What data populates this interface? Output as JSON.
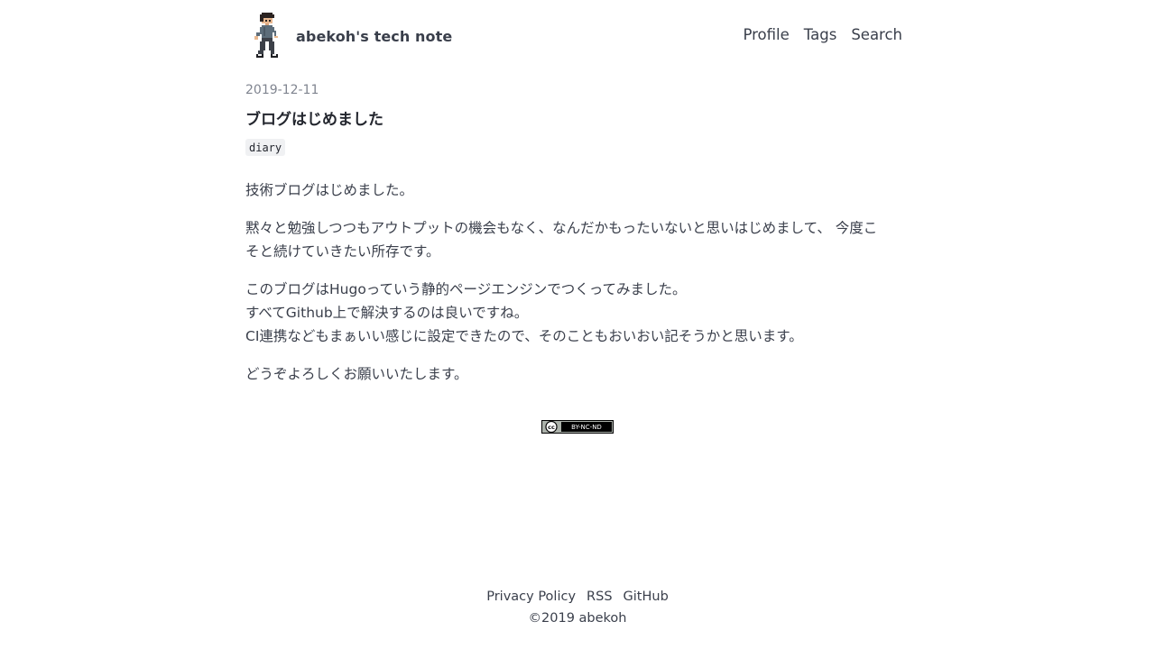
{
  "header": {
    "site_title": "abekoh's tech note",
    "avatar_icon": "pixel-character-avatar",
    "nav": [
      {
        "label": "Profile"
      },
      {
        "label": "Tags"
      },
      {
        "label": "Search"
      }
    ]
  },
  "post": {
    "date": "2019-12-11",
    "title": "ブログはじめました",
    "tags": [
      "diary"
    ],
    "paragraphs": [
      [
        "技術ブログはじめました。"
      ],
      [
        "黙々と勉強しつつもアウトプットの機会もなく、なんだかもったいないと思いはじめまして、 今度こ",
        "そと続けていきたい所存です。"
      ],
      [
        "このブログはHugoっていう静的ページエンジンでつくってみました。",
        "すべてGithub上で解決するのは良いですね。",
        "CI連携などもまぁいい感じに設定できたので、そのこともおいおい記そうかと思います。"
      ],
      [
        "どうぞよろしくお願いいたします。"
      ]
    ]
  },
  "license": {
    "badge_text": "BY-NC-ND",
    "cc_text": "cc"
  },
  "footer": {
    "links": [
      {
        "label": "Privacy Policy"
      },
      {
        "label": "RSS"
      },
      {
        "label": "GitHub"
      }
    ],
    "copyright": "©2019 abekoh"
  },
  "colors": {
    "text": "#3a3f4b",
    "title": "#23262e",
    "muted": "#808590",
    "tag_bg": "#f0f1f3",
    "background": "#ffffff"
  }
}
